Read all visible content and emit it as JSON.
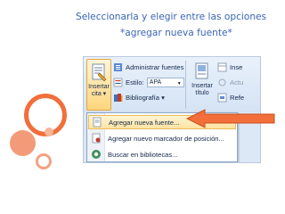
{
  "caption": {
    "line1": "Seleccionarla y elegir entre las opciones",
    "line2": "*agregar nueva fuente*"
  },
  "ribbon": {
    "insert_citation": {
      "line1": "Insertar",
      "line2": "cita ▾"
    },
    "manage_sources": "Administrar fuentes",
    "style_label": "Estilo:",
    "style_value": "APA",
    "bibliography": "Bibliografía ▾",
    "insert_title": {
      "line1": "Insertar",
      "line2": "título"
    },
    "insert_partial": "Inse",
    "update_partial": "Actu",
    "ref_partial": "Refe"
  },
  "menu": {
    "items": [
      {
        "label": "Agregar nueva fuente...",
        "icon": "add-source-icon",
        "highlighted": true
      },
      {
        "label": "Agregar nuevo marcador de posición...",
        "icon": "placeholder-icon",
        "highlighted": false
      },
      {
        "label": "Buscar en bibliotecas...",
        "icon": "search-library-icon",
        "highlighted": false
      }
    ]
  },
  "colors": {
    "caption": "#3a66b5",
    "accent_orange": "#f26e3a",
    "ribbon_bg": "#dde8f6",
    "menu_highlight": "#ffe3a0"
  }
}
